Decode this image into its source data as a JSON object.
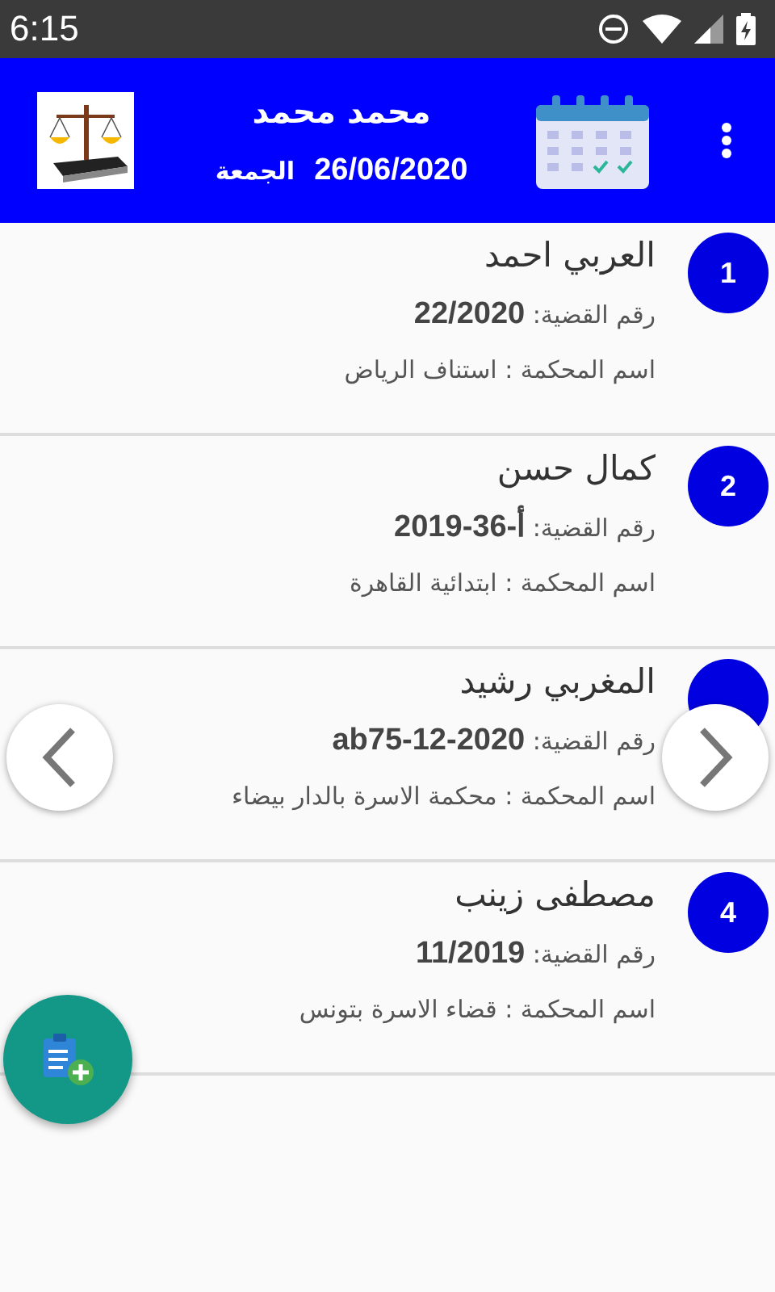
{
  "status_bar": {
    "time": "6:15"
  },
  "header": {
    "name": "محمد محمد",
    "day": "الجمعة",
    "date": "26/06/2020"
  },
  "cases": [
    {
      "number": "1",
      "name": "العربي احمد",
      "case_line": "رقم القضية: **22/2020**",
      "court_line": "اسم المحكمة : استناف الرياض"
    },
    {
      "number": "2",
      "name": "كمال حسن",
      "case_line": "رقم القضية: **أ-36-2019**",
      "court_line": "اسم المحكمة : ابتدائية القاهرة"
    },
    {
      "name": "المغربي رشيد",
      "case_line": "رقم القضية: **ab75-12-2020**",
      "court_line": "اسم المحكمة : محكمة الاسرة بالدار بيضاء"
    },
    {
      "number": "4",
      "name": "مصطفى زينب",
      "case_line": "رقم القضية: **11/2019**",
      "court_line": "اسم المحكمة : قضاء الاسرة بتونس"
    }
  ]
}
